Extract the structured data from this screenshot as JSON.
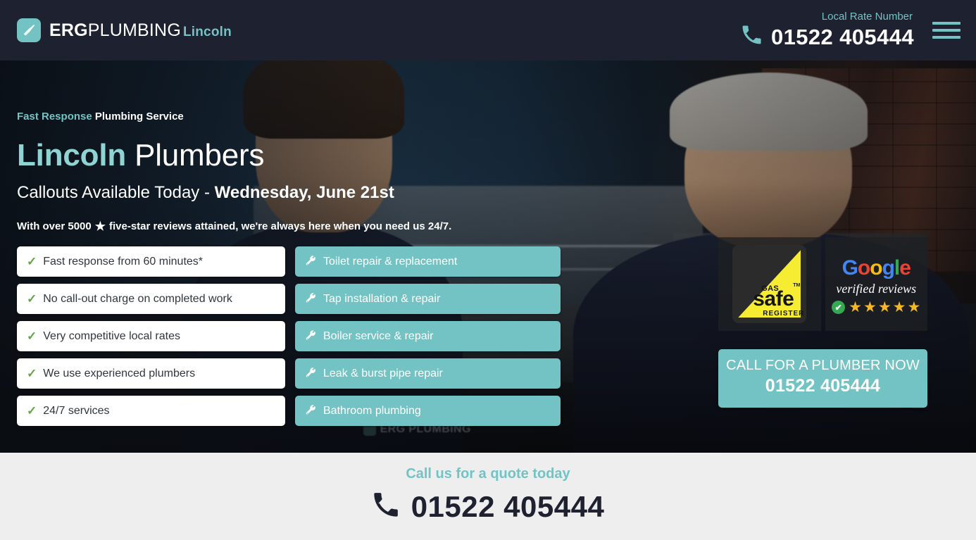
{
  "header": {
    "brand": {
      "erg": "ERG",
      "plumbing": "PLUMBING",
      "city": "Lincoln",
      "icon": "plunger-icon"
    },
    "contact_label": "Local Rate Number",
    "contact_number": "01522 405444",
    "phone_icon": "phone-icon",
    "menu_icon": "hamburger-menu-icon",
    "bg_color": "#1d2130",
    "accent_color": "#74c3c4"
  },
  "hero": {
    "eyebrow_accent": "Fast Response",
    "eyebrow_plain": "Plumbing Service",
    "title_city": "Lincoln",
    "title_rest": "Plumbers",
    "subtitle_prefix": "Callouts Available Today - ",
    "subtitle_date": "Wednesday, June 21st",
    "note_prefix": "With over 5000",
    "note_star": "★",
    "note_suffix": "five-star reviews attained, we're always here when you need us 24/7.",
    "uniform_logo_text": "ERG PLUMBING",
    "benefits": [
      "Fast response from 60 minutes*",
      "No call-out charge on completed work",
      "Very competitive local rates",
      "We use experienced plumbers",
      "24/7 services"
    ],
    "services": [
      "Toilet repair & replacement",
      "Tap installation & repair",
      "Boiler service & repair",
      "Leak & burst pipe repair",
      "Bathroom plumbing"
    ],
    "check_icon": "check-icon",
    "wrench_icon": "wrench-icon"
  },
  "badges": {
    "gas_safe": {
      "gas": "GAS",
      "safe": "safe",
      "register": "REGISTER",
      "tm": "TM",
      "color": "#f6ed33"
    },
    "google": {
      "letters": [
        "G",
        "o",
        "o",
        "g",
        "l",
        "e"
      ],
      "verified_text": "verified reviews",
      "stars": 5,
      "star_glyph": "★",
      "check_glyph": "✔",
      "star_color": "#f5b725",
      "check_color": "#34A853"
    }
  },
  "cta": {
    "line1": "CALL FOR A PLUMBER NOW",
    "number": "01522 405444",
    "bg_color": "#74c3c4"
  },
  "footer": {
    "label": "Call us for a quote today",
    "number": "01522 405444",
    "phone_icon": "phone-icon",
    "bg_color": "#eeeeee"
  }
}
